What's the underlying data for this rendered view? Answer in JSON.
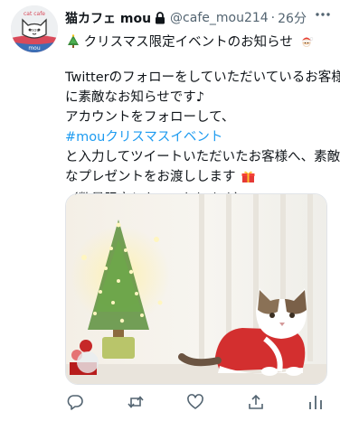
{
  "account": {
    "display_name": "猫カフェ mou",
    "handle": "@cafe_mou214",
    "separator": "·",
    "time": "26分",
    "avatar_text_top": "cat cafe",
    "avatar_text_bottom": "mou",
    "avatar_face_text": "mou"
  },
  "tweet": {
    "line1": "クリスマス限定イベントのお知らせ",
    "line2": "Twitterのフォローをしていただいているお客様",
    "line3": "に素敵なお知らせです♪",
    "line4": "アカウントをフォローして、",
    "hashtag": "#mouクリスマスイベント",
    "line6": "と入力してツイートいただいたお客様へ、素敵",
    "line7": "なプレゼントをお渡しします",
    "line8": "（数量限定となっております）"
  },
  "icons": {
    "lock": "lock-icon",
    "more": "more-icon",
    "tree": "christmas-tree-emoji",
    "santa": "santa-emoji",
    "gift": "gift-emoji",
    "reply": "reply-icon",
    "retweet": "retweet-icon",
    "like": "like-icon",
    "share": "share-icon",
    "analytics": "analytics-icon"
  },
  "colors": {
    "text": "#0f1419",
    "secondary": "#536471",
    "link": "#1d9bf0"
  }
}
